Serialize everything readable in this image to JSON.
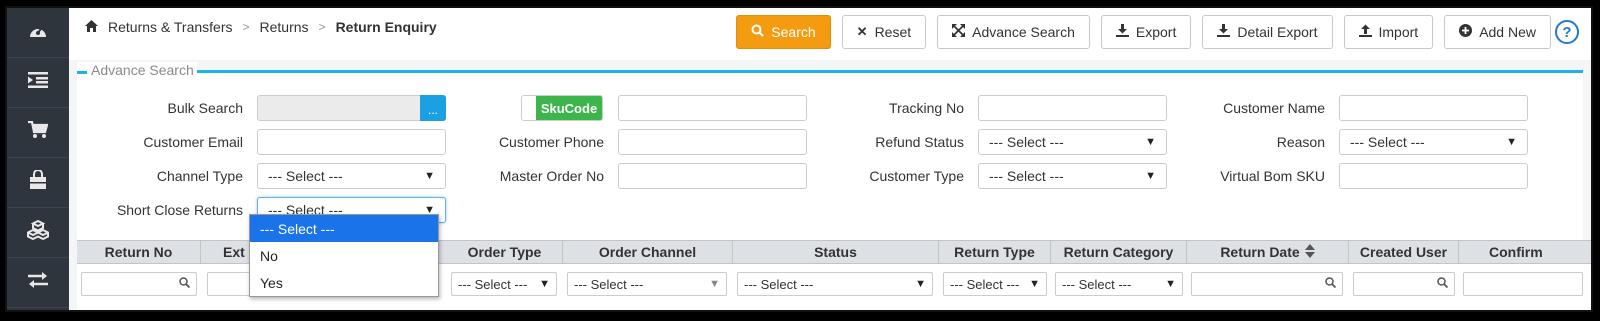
{
  "sidebar": {
    "items": [
      {
        "icon": "dashboard-icon",
        "glyph": "◔"
      },
      {
        "icon": "indent-icon",
        "glyph": "☰"
      },
      {
        "icon": "cart-icon",
        "glyph": "🛒"
      },
      {
        "icon": "shopping-bag-icon",
        "glyph": "👜"
      },
      {
        "icon": "cubes-icon",
        "glyph": "⧈"
      },
      {
        "icon": "exchange-icon",
        "glyph": "⇄"
      }
    ]
  },
  "breadcrumb": {
    "home_icon": "home-icon",
    "items": [
      "Returns & Transfers",
      "Returns",
      "Return Enquiry"
    ],
    "separator": ">"
  },
  "actions": {
    "search": "Search",
    "reset": "Reset",
    "advance_search": "Advance Search",
    "export": "Export",
    "detail_export": "Detail Export",
    "import": "Import",
    "add_new": "Add New",
    "help": "?"
  },
  "advance_search": {
    "legend": "Advance Search",
    "bulk_search": {
      "label": "Bulk Search",
      "button": "..."
    },
    "skucode_toggle": "SkuCode",
    "tracking_no": {
      "label": "Tracking No",
      "value": ""
    },
    "customer_name": {
      "label": "Customer Name",
      "value": ""
    },
    "customer_email": {
      "label": "Customer Email",
      "value": ""
    },
    "customer_phone": {
      "label": "Customer Phone",
      "value": ""
    },
    "refund_status": {
      "label": "Refund Status",
      "value": "--- Select ---"
    },
    "reason": {
      "label": "Reason",
      "value": "--- Select ---"
    },
    "channel_type": {
      "label": "Channel Type",
      "value": "--- Select ---"
    },
    "master_order_no": {
      "label": "Master Order No",
      "value": ""
    },
    "customer_type": {
      "label": "Customer Type",
      "value": "--- Select ---"
    },
    "virtual_bom_sku": {
      "label": "Virtual Bom SKU",
      "value": ""
    },
    "short_close_returns": {
      "label": "Short Close Returns",
      "value": "--- Select ---"
    }
  },
  "dropdown": {
    "options": [
      "--- Select ---",
      "No",
      "Yes"
    ],
    "selected_index": 0
  },
  "grid": {
    "columns": [
      "Return No",
      "Ext",
      "Order Type",
      "Order Channel",
      "Status",
      "Return Type",
      "Return Category",
      "Return Date",
      "Created User",
      "Confirm"
    ],
    "filters": {
      "order_type": "--- Select ---",
      "order_channel": "--- Select ---",
      "status": "--- Select ---",
      "return_type": "--- Select ---",
      "return_category": "--- Select ---"
    }
  },
  "colors": {
    "sidebar_bg": "#2f353d",
    "search_button": "#f39c12",
    "accent": "#19b5ea",
    "toggle_on": "#3cb64b",
    "selected_option": "#1a73e8"
  }
}
